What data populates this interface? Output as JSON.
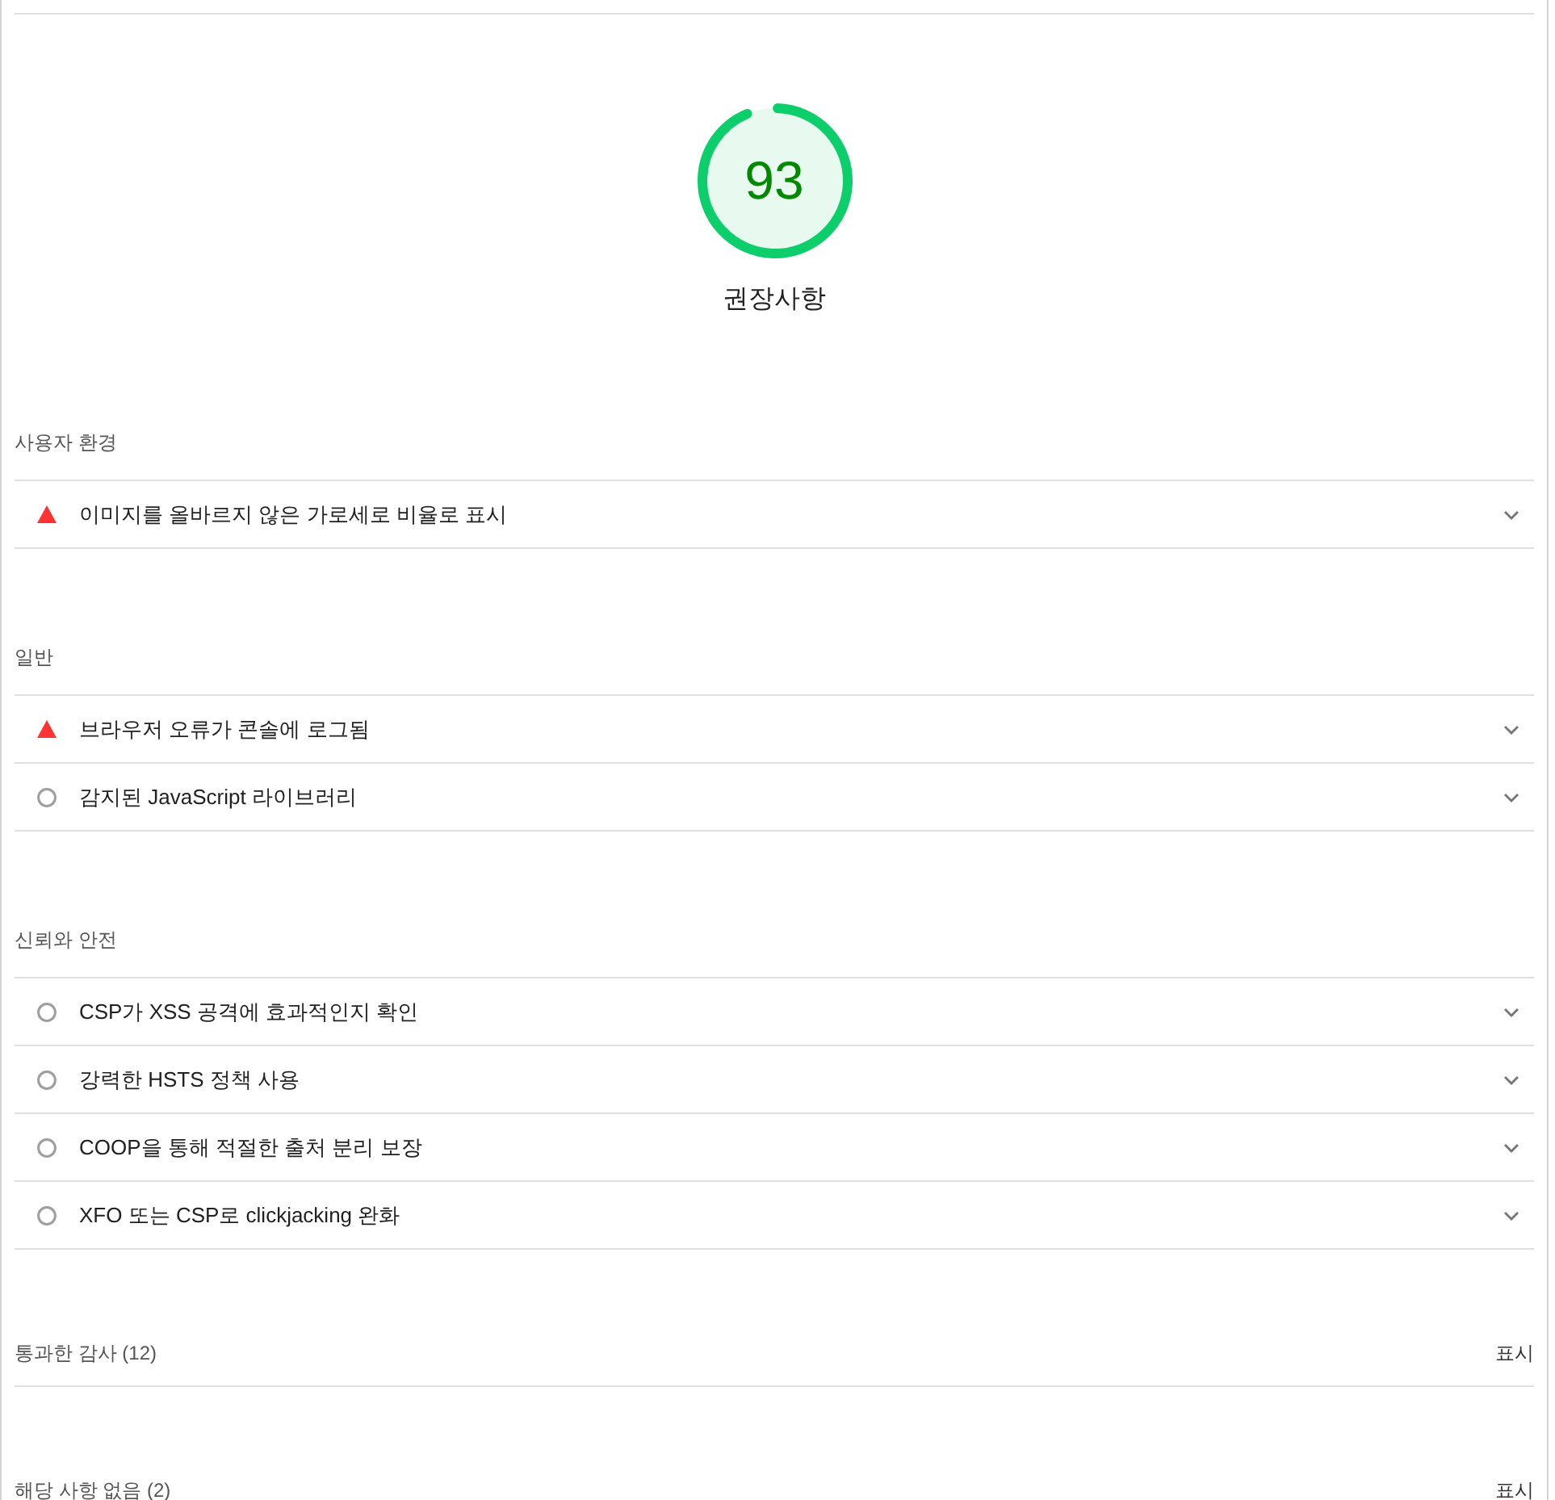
{
  "score_gauge": {
    "score": "93",
    "level": 0.93,
    "title": "권장사항"
  },
  "groups": [
    {
      "title": "사용자 환경",
      "audits": [
        {
          "kind": "fail",
          "label": "이미지를 올바르지 않은 가로세로 비율로 표시",
          "expanded": false
        }
      ]
    },
    {
      "title": "일반",
      "audits": [
        {
          "kind": "fail",
          "label": "브라우저 오류가 콘솔에 로그됨",
          "expanded": false
        },
        {
          "kind": "info",
          "label": "감지된 JavaScript 라이브러리",
          "expanded": false
        }
      ]
    },
    {
      "title": "신뢰와 안전",
      "audits": [
        {
          "kind": "info",
          "label": "CSP가 XSS 공격에 효과적인지 확인",
          "expanded": false
        },
        {
          "kind": "info",
          "label": "강력한 HSTS 정책 사용",
          "expanded": false
        },
        {
          "kind": "info",
          "label": "COOP을 통해 적절한 출처 분리 보장",
          "expanded": false
        },
        {
          "kind": "info",
          "label": "XFO 또는 CSP로 clickjacking 완화",
          "expanded": false
        }
      ]
    }
  ],
  "collapsed_groups": [
    {
      "title": "통과한 감사 (12)",
      "toggle": "표시"
    },
    {
      "title": "해당 사항 없음 (2)",
      "toggle": "표시"
    }
  ]
}
